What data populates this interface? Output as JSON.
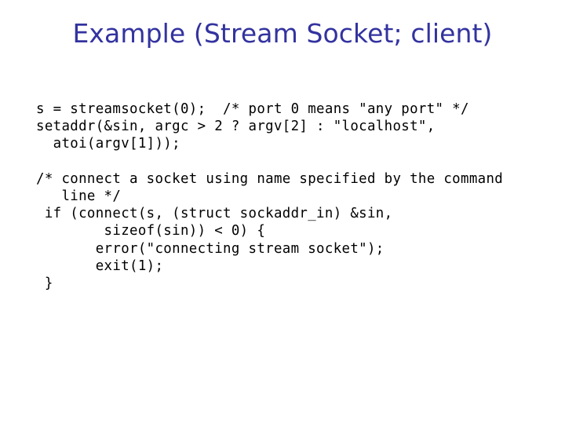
{
  "slide": {
    "background_color": "#ffffff",
    "title": {
      "text": "Example (Stream Socket; client)",
      "color": "#3333a0",
      "lines": [
        "Example (Stream Socket;",
        "client)"
      ]
    },
    "code": {
      "color": "#000000",
      "language": "c",
      "text": "s = streamsocket(0);  /* port 0 means \"any port\" */\nsetaddr(&sin, argc > 2 ? argv[2] : \"localhost\",\n  atoi(argv[1]));\n\n/* connect a socket using name specified by the command\n   line */\n if (connect(s, (struct sockaddr_in) &sin,\n        sizeof(sin)) < 0) {\n       error(\"connecting stream socket\");\n       exit(1);\n }",
      "lines": [
        "s = streamsocket(0);  /* port 0 means \"any port\" */",
        "setaddr(&sin, argc > 2 ? argv[2] : \"localhost\",",
        "  atoi(argv[1]));",
        "",
        "/* connect a socket using name specified by the command",
        "   line */",
        " if (connect(s, (struct sockaddr_in) &sin,",
        "        sizeof(sin)) < 0) {",
        "       error(\"connecting stream socket\");",
        "       exit(1);",
        " }"
      ]
    }
  }
}
